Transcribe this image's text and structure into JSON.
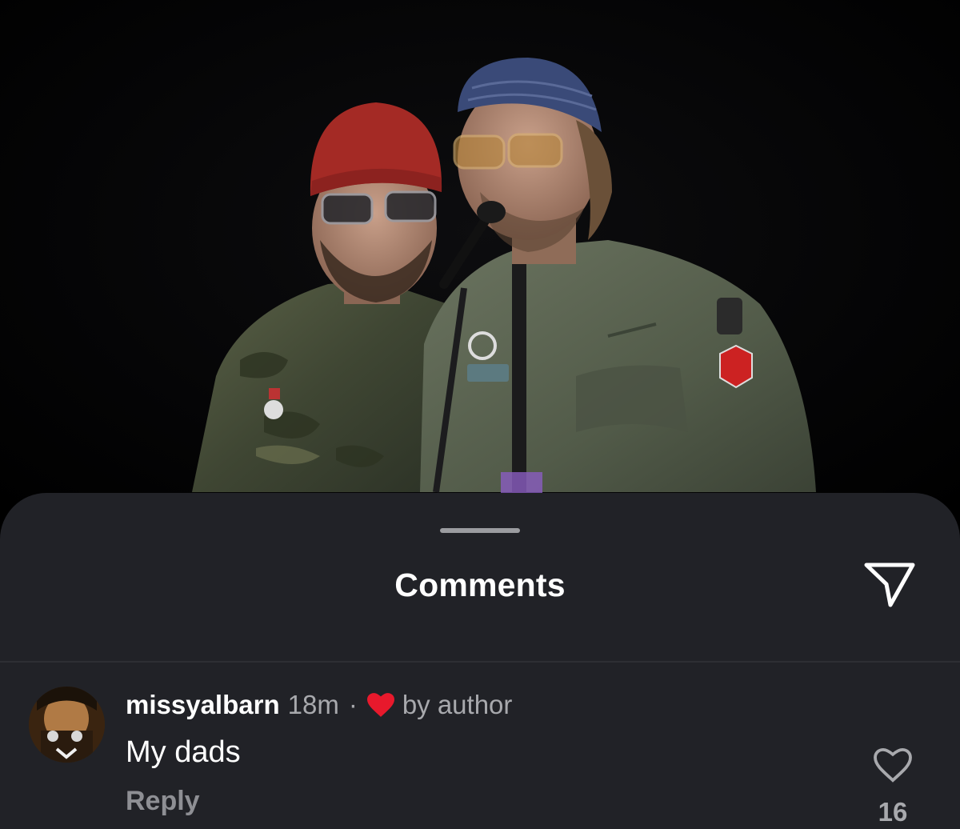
{
  "sheet": {
    "title": "Comments"
  },
  "comments": [
    {
      "username": "missyalbarn",
      "time": "18m",
      "separator": "·",
      "liked_badge": "by author",
      "text": "My dads",
      "reply_label": "Reply",
      "like_count": "16"
    }
  ],
  "colors": {
    "sheet_bg": "#212227",
    "heart_red": "#e8192c",
    "muted_text": "#a8a9ad"
  }
}
